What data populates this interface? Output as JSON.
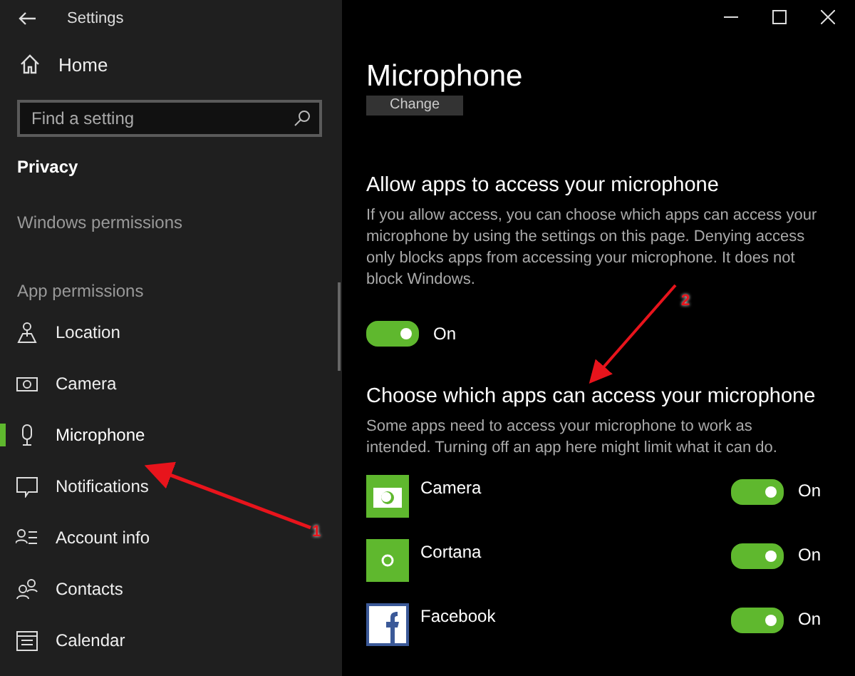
{
  "window": {
    "title": "Settings"
  },
  "sidebar": {
    "home": "Home",
    "search": {
      "placeholder": "Find a setting"
    },
    "section": "Privacy",
    "groups": [
      {
        "label": "Windows permissions"
      },
      {
        "label": "App permissions"
      }
    ],
    "items": [
      {
        "label": "Location",
        "selected": false
      },
      {
        "label": "Camera",
        "selected": false
      },
      {
        "label": "Microphone",
        "selected": true
      },
      {
        "label": "Notifications",
        "selected": false
      },
      {
        "label": "Account info",
        "selected": false
      },
      {
        "label": "Contacts",
        "selected": false
      },
      {
        "label": "Calendar",
        "selected": false
      }
    ]
  },
  "page": {
    "title": "Microphone",
    "change_button": "Change",
    "allow": {
      "heading": "Allow apps to access your microphone",
      "text": "If you allow access, you can choose which apps can access your microphone by using the settings on this page. Denying access only blocks apps from accessing your microphone. It does not block Windows.",
      "toggle": {
        "on": true,
        "label": "On"
      }
    },
    "choose": {
      "heading": "Choose which apps can access your microphone",
      "text": "Some apps need to access your microphone to work as intended. Turning off an app here might limit what it can do."
    },
    "apps": [
      {
        "name": "Camera",
        "on": true,
        "label": "On"
      },
      {
        "name": "Cortana",
        "on": true,
        "label": "On"
      },
      {
        "name": "Facebook",
        "on": true,
        "label": "On"
      }
    ]
  },
  "annotations": [
    {
      "label": "1"
    },
    {
      "label": "2"
    }
  ]
}
